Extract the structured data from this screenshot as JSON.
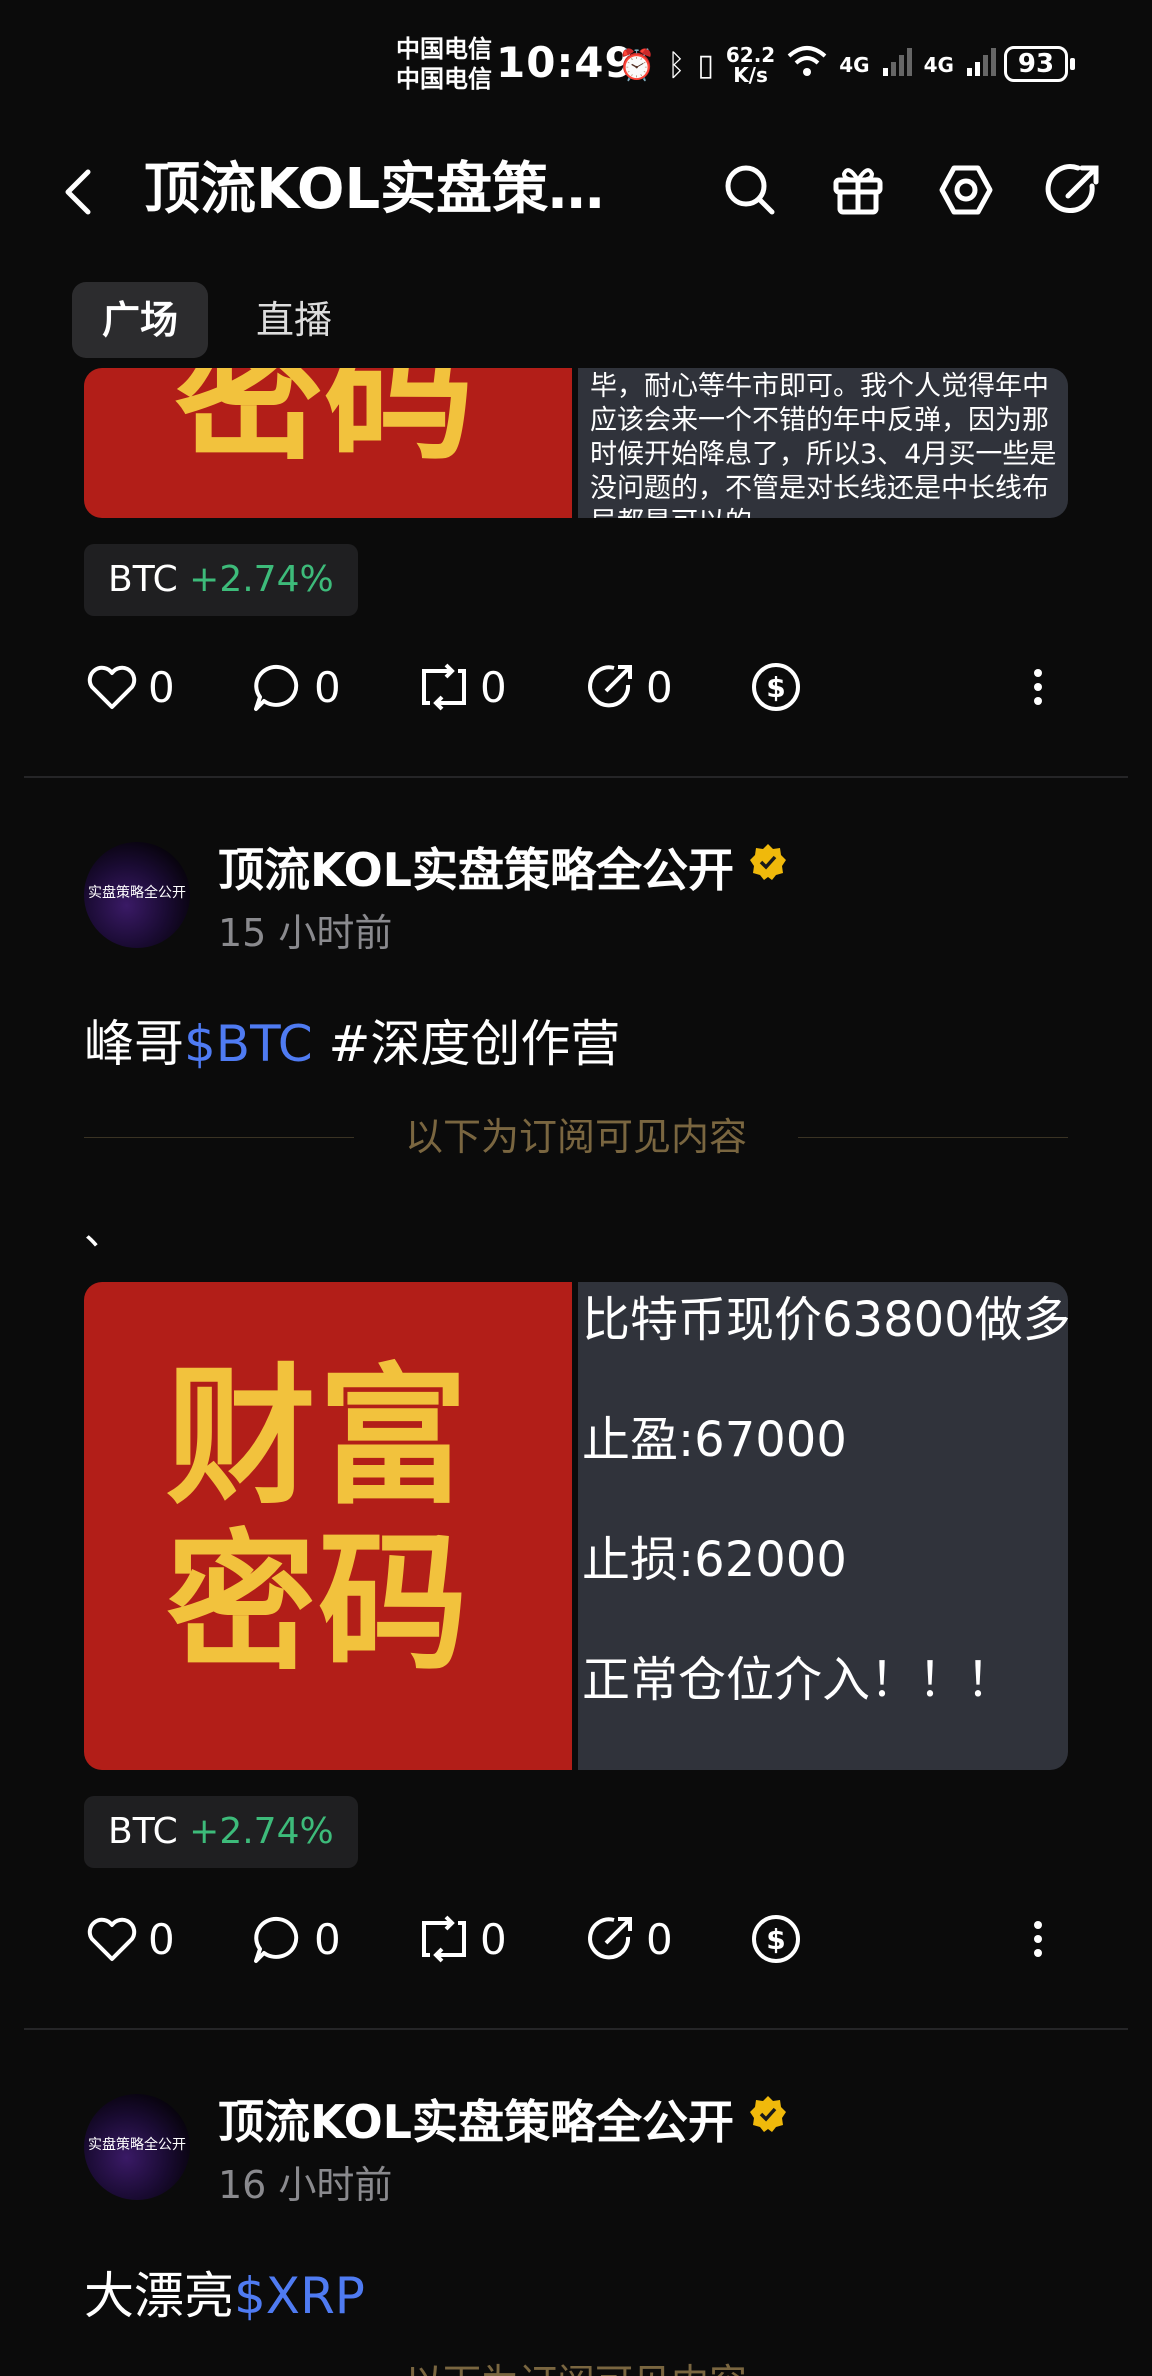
{
  "status_bar": {
    "carrier_1": "中国电信",
    "carrier_2": "中国电信",
    "time": "10:49",
    "net_speed_value": "62.2",
    "net_speed_unit": "K/s",
    "net_1": "4G",
    "net_2": "4G",
    "battery": "93"
  },
  "header": {
    "title": "顶流KOL实盘策…"
  },
  "tabs": [
    {
      "label": "广场",
      "active": true
    },
    {
      "label": "直播",
      "active": false
    }
  ],
  "post_top": {
    "image_red_text": "密码",
    "image_grey_lines": [
      "毕，耐心等牛市即可。我个人觉得年中",
      "应该会来一个不错的年中反弹，因为那",
      "时候开始降息了，所以3、4月买一些是",
      "没问题的，不管是对长线还是中长线布",
      "局都是可以的"
    ],
    "tag_symbol": "BTC",
    "tag_change": "+2.74%",
    "likes": "0",
    "comments": "0",
    "reposts": "0",
    "shares": "0"
  },
  "post_2": {
    "author": "顶流KOL实盘策略全公开",
    "avatar_text": "实盘策略全公开",
    "time": "15 小时前",
    "text_plain": "峰哥",
    "text_cashtag": "$BTC",
    "text_hashtag": " #深度创作营",
    "subscribe_label": "以下为订阅可见内容",
    "extra_mark": "、",
    "image_red_line1": "财富",
    "image_red_line2": "密码",
    "image_grey_lines": [
      "比特币现价63800做多",
      "止盈:67000",
      "止损:62000",
      "正常仓位介入！！！"
    ],
    "tag_symbol": "BTC",
    "tag_change": "+2.74%",
    "likes": "0",
    "comments": "0",
    "reposts": "0",
    "shares": "0"
  },
  "post_3": {
    "author": "顶流KOL实盘策略全公开",
    "avatar_text": "实盘策略全公开",
    "time": "16 小时前",
    "text_plain": "大漂亮",
    "text_cashtag": "$XRP",
    "subscribe_label": "以下为订阅可见内容"
  },
  "colors": {
    "background": "#0b0b0b",
    "link": "#4f7bf2",
    "positive": "#3dbb7a",
    "verified": "#f0b90b",
    "image_red": "#b21e18",
    "image_gold": "#f2c23d"
  }
}
